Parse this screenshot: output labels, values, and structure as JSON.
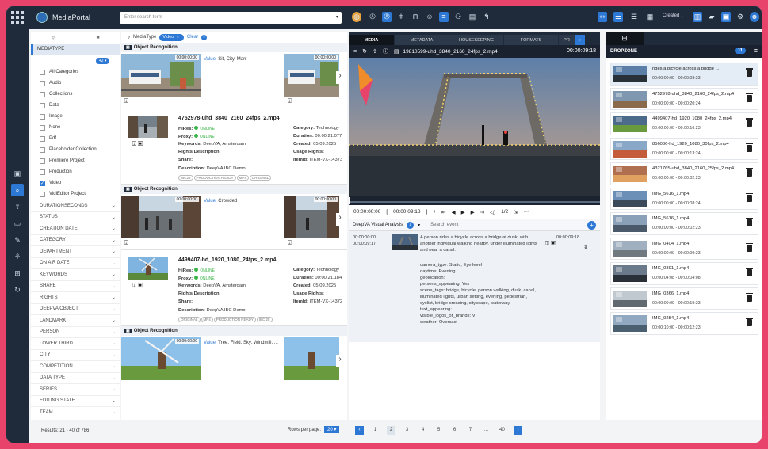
{
  "app": {
    "name": "MediaPortal"
  },
  "search": {
    "placeholder": "Enter search term"
  },
  "topbar": {
    "created_label": "Created"
  },
  "facets": {
    "mediatype_label": "MEDIATYPE",
    "count_badge": "42",
    "items": [
      {
        "label": "All Categories",
        "checked": false
      },
      {
        "label": "Audio",
        "checked": false
      },
      {
        "label": "Collections",
        "checked": false
      },
      {
        "label": "Data",
        "checked": false
      },
      {
        "label": "Image",
        "checked": false
      },
      {
        "label": "None",
        "checked": false
      },
      {
        "label": "Pdf",
        "checked": false
      },
      {
        "label": "Placeholder Collection",
        "checked": false
      },
      {
        "label": "Premiere Project",
        "checked": false
      },
      {
        "label": "Production",
        "checked": false
      },
      {
        "label": "Video",
        "checked": true
      },
      {
        "label": "VidiEditor Project",
        "checked": false
      }
    ],
    "sections": [
      "DURATIONSECONDS",
      "STATUS",
      "CREATION DATE",
      "CATEGORY",
      "DEPARTMENT",
      "ON AIR DATE",
      "KEYWORDS",
      "SHARE",
      "RIGHTS",
      "DEEPVA OBJECT",
      "LANDMARK",
      "PERSON",
      "LOWER THIRD",
      "CITY",
      "COMPETITION",
      "DATA TYPE",
      "SERIES",
      "EDITING STATE",
      "TEAM"
    ]
  },
  "results": {
    "text": "Results: 21 - 40 of 786"
  },
  "filter": {
    "mediatype": "MediaType",
    "chip": "Video",
    "clear": "Clear"
  },
  "groups": [
    {
      "header": "Object Recognition",
      "timecode": "00:00:00:00",
      "value_label": "Value:",
      "value": "Sit, City, Man"
    },
    {
      "header": "Object Recognition",
      "timecode": "00:00:00:00",
      "value_label": "Value:",
      "value": "Crowded"
    },
    {
      "header": "Object Recognition",
      "timecode": "00:00:00:00",
      "value_label": "Value:",
      "value": "Tree, Field, Sky, Windmill, ..."
    }
  ],
  "cards": [
    {
      "title": "4752978-uhd_3840_2160_24fps_2.mp4",
      "hires_label": "HiRes:",
      "hires": "ONLINE",
      "proxy_label": "Proxy:",
      "proxy": "ONLINE",
      "keywords_label": "Keywords:",
      "keywords": "DeepVA, Amsterdam",
      "rights_label": "Rights Description:",
      "share_label": "Share:",
      "description_label": "Description:",
      "description": "DeepVA IBC Demo",
      "category_label": "Category:",
      "category": "Technology",
      "duration_label": "Duration:",
      "duration": "00:00:21.077",
      "created_label": "Created:",
      "created": "05.09.2025",
      "usage_label": "Usage Rights:",
      "itemid_label": "ItemId:",
      "itemid": "ITEM-VX-14373",
      "tags": [
        "IBC25",
        "PRODUCTION READY",
        "MP4",
        "ORIGINAL"
      ]
    },
    {
      "title": "4499407-hd_1920_1080_24fps_2.mp4",
      "hires_label": "HiRes:",
      "hires": "ONLINE",
      "proxy_label": "Proxy:",
      "proxy": "ONLINE",
      "keywords_label": "Keywords:",
      "keywords": "DeepVA, Amsterdam",
      "rights_label": "Rights Description:",
      "share_label": "Share:",
      "description_label": "Description:",
      "description": "DeepVA IBC Demo",
      "category_label": "Category:",
      "category": "Technology",
      "duration_label": "Duration:",
      "duration": "00:00:21.184",
      "created_label": "Created:",
      "created": "05.09.2025",
      "usage_label": "Usage Rights:",
      "itemid_label": "ItemId:",
      "itemid": "ITEM-VX-14372",
      "tags": [
        "ORIGINAL",
        "MP4",
        "PRODUCTION READY",
        "IBC 25"
      ]
    }
  ],
  "player": {
    "tabs": [
      "MEDIA",
      "METADATA",
      "HOUSEKEEPING",
      "FORMATS",
      "PR"
    ],
    "filename": "19810599-uhd_3840_2160_24fps_2.mp4",
    "time": "00:00:09:18",
    "tc_in": "00:00:00:00",
    "tc_mark": "00:00:09:18",
    "volume": "1/2",
    "analysis_label": "DeepVA Visual Analysis",
    "analysis_count": "1",
    "search_placeholder": "Search event",
    "segment": {
      "start": "00:00:00:00",
      "end": "00:00:09:17",
      "end_right": "00:00:09:18",
      "description": "A person rides a bicycle across a bridge at dusk, with another individual walking nearby, under illuminated lights and near a canal.",
      "meta": [
        "camera_type: Static, Eye level",
        "daytime: Evening",
        "geolocation:",
        "persons_appearing: Yes",
        "scene_tags: bridge, bicycle, person walking, dusk, canal, illuminated lights, urban setting, evening, pedestrian, cyclist, bridge crossing, cityscape, waterway",
        "text_appearing:",
        "visible_logos_or_brands: V",
        "weather: Overcast"
      ]
    }
  },
  "pagination": {
    "rows_label": "Rows per page:",
    "rows_value": "20",
    "pages": [
      "1",
      "2",
      "3",
      "4",
      "5",
      "6",
      "7",
      "...",
      "40"
    ],
    "current": "2"
  },
  "dropzone": {
    "title": "DROPZONE",
    "count": "11",
    "items": [
      {
        "name": "rides a bicycle across a bridge ...",
        "time": "00:00:00:00 - 00:00:08:23",
        "selected": true
      },
      {
        "name": "4752978-uhd_3840_2160_24fps_2.mp4",
        "time": "00:00:00:00 - 00:00:20:24",
        "selected": false
      },
      {
        "name": "4499407-hd_1920_1080_24fps_2.mp4",
        "time": "00:00:00:00 - 00:00:16:23",
        "selected": false
      },
      {
        "name": "856036-hd_1920_1080_30fps_2.mp4",
        "time": "00:00:00:00 - 00:00:13:24",
        "selected": false
      },
      {
        "name": "4321765-uhd_3840_2160_25fps_2.mp4",
        "time": "00:00:00:00 - 00:00:02:23",
        "selected": false
      },
      {
        "name": "IMG_5616_1.mp4",
        "time": "00:00:00:00 - 00:00:08:24",
        "selected": false
      },
      {
        "name": "IMG_5616_1.mp4",
        "time": "00:00:00:00 - 00:00:02:23",
        "selected": false
      },
      {
        "name": "IMG_0404_1.mp4",
        "time": "00:00:00:00 - 00:00:09:23",
        "selected": false
      },
      {
        "name": "IMG_0391_1.mp4",
        "time": "00:00:04:08 - 00:00:04:08",
        "selected": false
      },
      {
        "name": "IMG_0366_1.mp4",
        "time": "00:00:00:00 - 00:00:19:23",
        "selected": false
      },
      {
        "name": "IMG_9284_1.mp4",
        "time": "00:00:10:00 - 00:00:12:23",
        "selected": false
      }
    ]
  }
}
